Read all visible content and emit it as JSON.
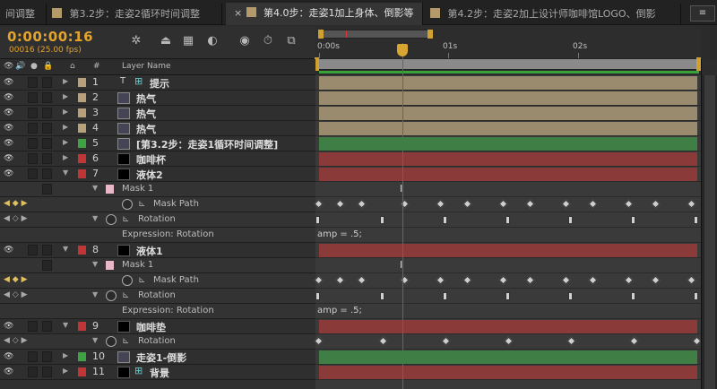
{
  "tabs": [
    {
      "label": "间调整",
      "color": "#2a2a2a"
    },
    {
      "label": "第3.2步：走姿2循环时间调整",
      "color": "#b49a6a"
    },
    {
      "label": "第4.0步：走姿1加上身体、倒影等",
      "color": "#b49a6a"
    },
    {
      "label": "第4.2步：走姿2加上设计师咖啡馆LOGO、倒影",
      "color": "#b49a6a"
    }
  ],
  "menu_icon": "≡",
  "timecode": "0:00:00:16",
  "fps": "00016 (25.00 fps)",
  "column_header": {
    "hash": "#",
    "layer_name": "Layer Name"
  },
  "ruler": {
    "ticks": [
      "0:00s",
      "01s",
      "02s"
    ]
  },
  "layers": [
    {
      "num": "1",
      "name": "提示",
      "color": "#b8a07a",
      "icon": "text-icon",
      "type": "layer"
    },
    {
      "num": "2",
      "name": "热气",
      "color": "#b8a07a",
      "icon": "comp-icon",
      "type": "layer"
    },
    {
      "num": "3",
      "name": "热气",
      "color": "#b8a07a",
      "icon": "comp-icon",
      "type": "layer"
    },
    {
      "num": "4",
      "name": "热气",
      "color": "#b8a07a",
      "icon": "comp-icon",
      "type": "layer"
    },
    {
      "num": "5",
      "name": "[第3.2步：走姿1循环时间调整]",
      "color": "#3fa345",
      "icon": "comp-icon",
      "type": "layer"
    },
    {
      "num": "6",
      "name": "咖啡杯",
      "color": "#c03636",
      "icon": "solid-icon",
      "type": "layer"
    },
    {
      "num": "7",
      "name": "液体2",
      "color": "#c03636",
      "icon": "solid-icon",
      "type": "layer"
    },
    {
      "name": "Mask 1",
      "type": "mask"
    },
    {
      "name": "Mask Path",
      "type": "prop"
    },
    {
      "name": "Rotation",
      "type": "prop2"
    },
    {
      "name": "Expression: Rotation",
      "type": "expr",
      "expr": "amp = .5;"
    },
    {
      "num": "8",
      "name": "液体1",
      "color": "#c03636",
      "icon": "solid-icon",
      "type": "layer"
    },
    {
      "name": "Mask 1",
      "type": "mask"
    },
    {
      "name": "Mask Path",
      "type": "prop"
    },
    {
      "name": "Rotation",
      "type": "prop2"
    },
    {
      "name": "Expression: Rotation",
      "type": "expr",
      "expr": "amp = .5;"
    },
    {
      "num": "9",
      "name": "咖啡垫",
      "color": "#c03636",
      "icon": "solid-icon",
      "type": "layer"
    },
    {
      "name": "Rotation",
      "type": "prop2"
    },
    {
      "num": "10",
      "name": "走姿1-倒影",
      "color": "#3fa345",
      "icon": "comp-icon",
      "type": "layer"
    },
    {
      "num": "11",
      "name": "背景",
      "color": "#c03636",
      "icon": "solid-icon",
      "type": "layer"
    }
  ],
  "bar_colors": {
    "tan": "#9a8b6e",
    "green": "#3f7f45",
    "red": "#8b3a3a"
  }
}
